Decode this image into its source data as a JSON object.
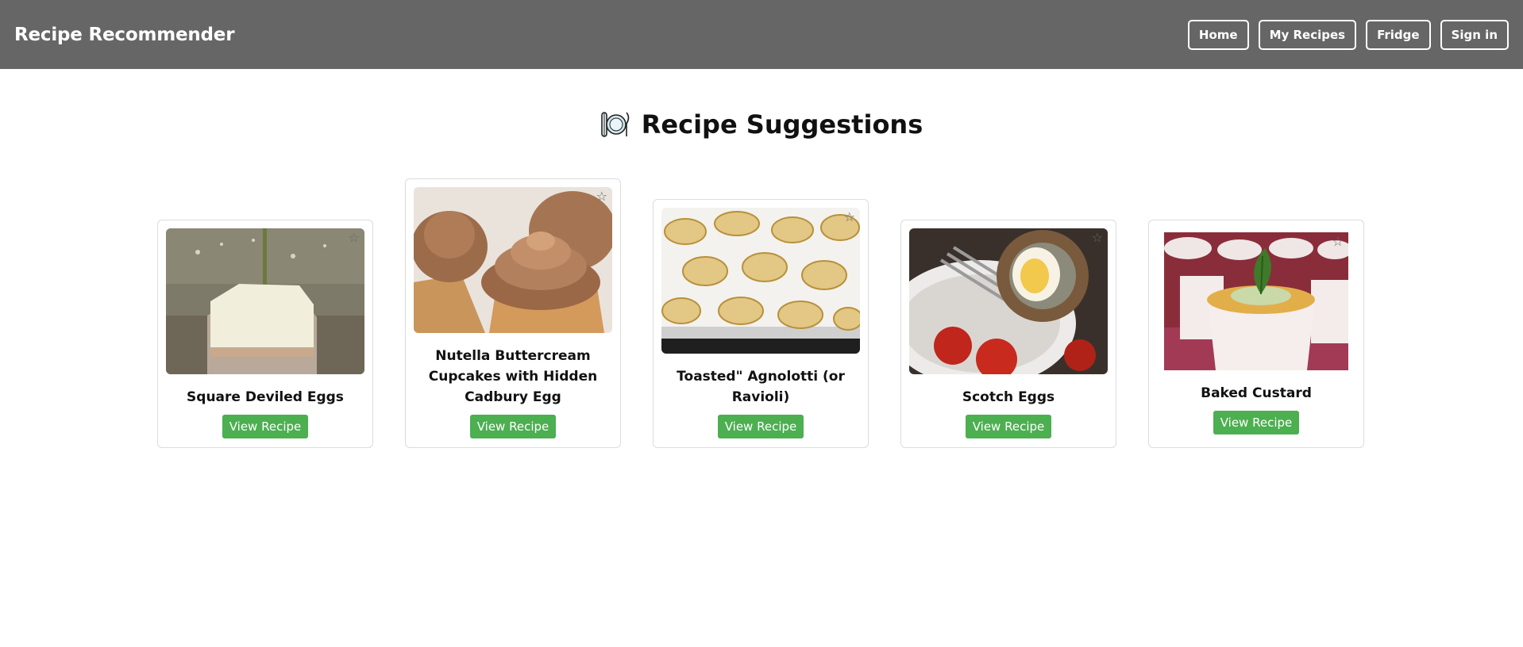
{
  "navbar": {
    "brand": "Recipe Recommender",
    "buttons": [
      "Home",
      "My Recipes",
      "Fridge",
      "Sign in"
    ]
  },
  "page": {
    "title": "Recipe Suggestions",
    "title_icon": "plate-cutlery-icon"
  },
  "recipes": [
    {
      "title": "Square Deviled Eggs",
      "button": "View Recipe",
      "image": "deviled-eggs-photo",
      "favorite_icon": "☆"
    },
    {
      "title": "Nutella Buttercream Cupcakes with Hidden Cadbury Egg",
      "button": "View Recipe",
      "image": "cupcakes-photo",
      "favorite_icon": "☆"
    },
    {
      "title": "Toasted\" Agnolotti (or Ravioli)",
      "button": "View Recipe",
      "image": "agnolotti-photo",
      "favorite_icon": "☆"
    },
    {
      "title": "Scotch Eggs",
      "button": "View Recipe",
      "image": "scotch-eggs-photo",
      "favorite_icon": "☆"
    },
    {
      "title": "Baked Custard",
      "button": "View Recipe",
      "image": "custard-photo",
      "favorite_icon": "☆"
    }
  ],
  "colors": {
    "navbar_bg": "#666666",
    "view_button": "#4caf50"
  }
}
